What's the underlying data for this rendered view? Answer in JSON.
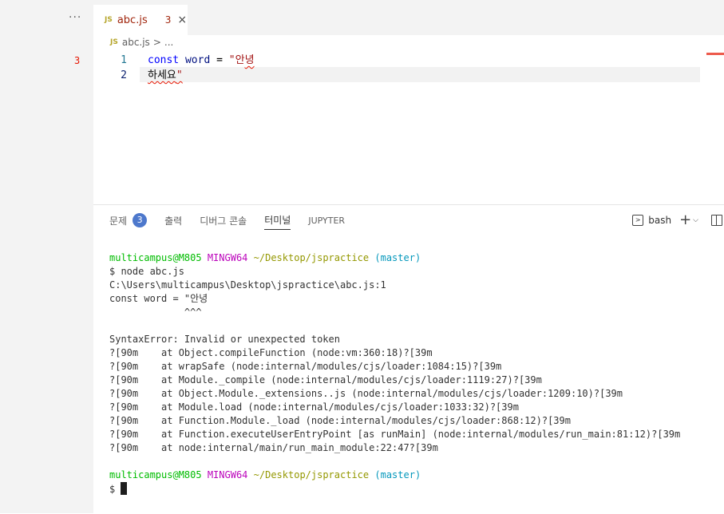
{
  "sidebar": {
    "more_label": "···",
    "gutter_error": "3"
  },
  "tab": {
    "lang_badge": "JS",
    "filename": "abc.js",
    "problem_count": "3",
    "close_glyph": "×"
  },
  "breadcrumb": {
    "lang_badge": "JS",
    "file": "abc.js",
    "separator": ">",
    "more": "..."
  },
  "editor": {
    "lines": [
      {
        "number": "1",
        "kw": "const",
        "var": "word",
        "op": "=",
        "str_ok": "\"안",
        "str_err": "녕"
      },
      {
        "number": "2",
        "text_err": "하세요",
        "text_end": "\""
      }
    ]
  },
  "panel": {
    "tabs": [
      {
        "label": "문제",
        "badge": "3"
      },
      {
        "label": "출력"
      },
      {
        "label": "디버그 콘솔"
      },
      {
        "label": "터미널"
      },
      {
        "label": "JUPYTER"
      }
    ],
    "actions": {
      "shell": "bash",
      "shell_icon_glyph": ">",
      "plus": "+",
      "chevron": "⌵"
    }
  },
  "terminal": {
    "prompt1": {
      "user": "multicampus@M805",
      "host": "MINGW64",
      "path": "~/Desktop/jspractice",
      "branch": "(master)"
    },
    "command": "$ node abc.js",
    "output": [
      "C:\\Users\\multicampus\\Desktop\\jspractice\\abc.js:1",
      "const word = \"안녕",
      "             ^^^",
      "",
      "SyntaxError: Invalid or unexpected token",
      "?[90m    at Object.compileFunction (node:vm:360:18)?[39m",
      "?[90m    at wrapSafe (node:internal/modules/cjs/loader:1084:15)?[39m",
      "?[90m    at Module._compile (node:internal/modules/cjs/loader:1119:27)?[39m",
      "?[90m    at Object.Module._extensions..js (node:internal/modules/cjs/loader:1209:10)?[39m",
      "?[90m    at Module.load (node:internal/modules/cjs/loader:1033:32)?[39m",
      "?[90m    at Function.Module._load (node:internal/modules/cjs/loader:868:12)?[39m",
      "?[90m    at Function.executeUserEntryPoint [as runMain] (node:internal/modules/run_main:81:12)?[39m",
      "?[90m    at node:internal/main/run_main_module:22:47?[39m",
      ""
    ],
    "prompt2": {
      "user": "multicampus@M805",
      "host": "MINGW64",
      "path": "~/Desktop/jspractice",
      "branch": "(master)"
    },
    "final_prompt": "$"
  }
}
